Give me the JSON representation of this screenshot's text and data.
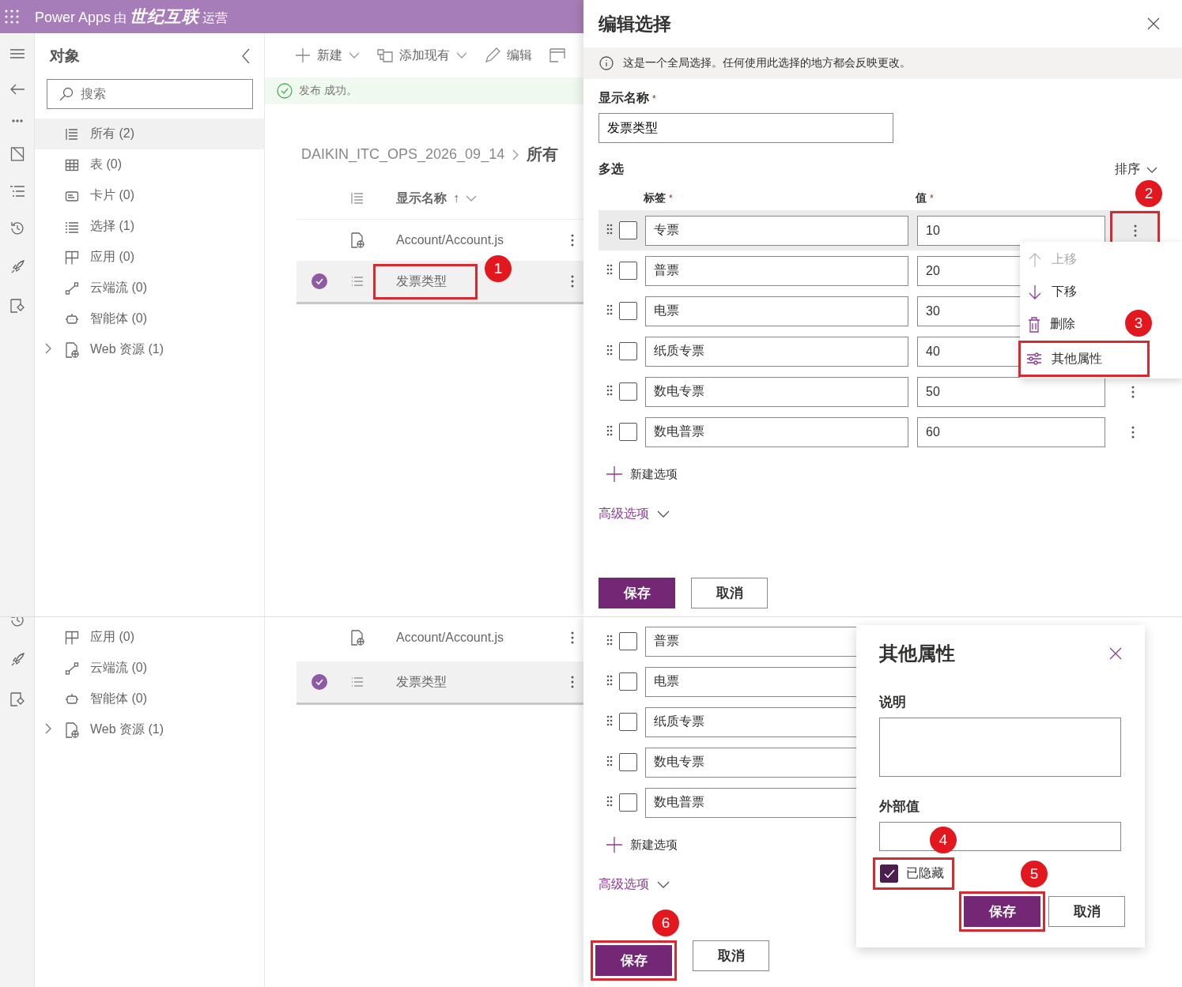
{
  "top": {
    "app_bar": {
      "product": "Power Apps",
      "by": "由",
      "operator": "世纪互联",
      "suffix": "运营"
    },
    "sidebar": {
      "title": "对象",
      "search": {
        "placeholder": "搜索"
      },
      "items": [
        {
          "label": "所有",
          "count": "(2)",
          "selected": true
        },
        {
          "label": "表",
          "count": "(0)",
          "selected": false
        },
        {
          "label": "卡片",
          "count": "(0)",
          "selected": false
        },
        {
          "label": "选择",
          "count": "(1)",
          "selected": false
        },
        {
          "label": "应用",
          "count": "(0)",
          "selected": false
        },
        {
          "label": "云端流",
          "count": "(0)",
          "selected": false
        },
        {
          "label": "智能体",
          "count": "(0)",
          "selected": false
        },
        {
          "label": "Web 资源",
          "count": "(1)",
          "selected": false,
          "expanded": false
        }
      ]
    },
    "toolbar": [
      {
        "label": "新建",
        "has_menu": true
      },
      {
        "label": "添加现有",
        "has_menu": true
      },
      {
        "label": "编辑",
        "has_menu": false
      }
    ],
    "notice": "发布 成功。",
    "breadcrumb": [
      "DAIKIN_ITC_OPS_2026_09_14",
      "所有"
    ],
    "table": {
      "column": "显示名称",
      "sort_mark": "↑",
      "rows": [
        {
          "name": "Account/Account.js",
          "selected": false
        },
        {
          "name": "发票类型",
          "selected": true,
          "badge": "1"
        }
      ]
    },
    "panel": {
      "title": "编辑选择",
      "info": "这是一个全局选择。任何使用此选择的地方都会反映更改。",
      "name_label": "显示名称",
      "name_required_mark": "*",
      "name_value": "发票类型",
      "section": "多选",
      "sort": "排序",
      "label_column": "标签",
      "label_required_mark": "*",
      "value_column": "值",
      "value_required_mark": "*",
      "options": [
        {
          "label": "专票",
          "value": "10",
          "checked": false,
          "selected": true
        },
        {
          "label": "普票",
          "value": "20",
          "checked": false,
          "selected": false
        },
        {
          "label": "电票",
          "value": "30",
          "checked": false,
          "selected": false
        },
        {
          "label": "纸质专票",
          "value": "40",
          "checked": false,
          "selected": false
        },
        {
          "label": "数电专票",
          "value": "50",
          "checked": false,
          "selected": false
        },
        {
          "label": "数电普票",
          "value": "60",
          "checked": false,
          "selected": false
        }
      ],
      "more_badge": "2",
      "menu": [
        {
          "label": "上移",
          "disabled": true
        },
        {
          "label": "下移",
          "disabled": false
        },
        {
          "label": "删除",
          "disabled": false
        },
        {
          "label": "其他属性",
          "disabled": false,
          "badge": "3"
        }
      ],
      "add": "新建选项",
      "advanced": "高级选项",
      "buttons": [
        {
          "label": "保存",
          "kind": "primary"
        },
        {
          "label": "取消",
          "kind": "secondary"
        }
      ]
    }
  },
  "bottom": {
    "sidebar_items": [
      {
        "label": "应用",
        "count": "(0)"
      },
      {
        "label": "云端流",
        "count": "(0)"
      },
      {
        "label": "智能体",
        "count": "(0)"
      },
      {
        "label": "Web 资源",
        "count": "(1)",
        "expanded": false
      }
    ],
    "table_rows": [
      {
        "name": "Account/Account.js",
        "selected": false
      },
      {
        "name": "发票类型",
        "selected": true
      }
    ],
    "options": [
      {
        "label": "普票",
        "checked": false
      },
      {
        "label": "电票",
        "checked": false
      },
      {
        "label": "纸质专票",
        "checked": false
      },
      {
        "label": "数电专票",
        "checked": false
      },
      {
        "label": "数电普票",
        "checked": false
      }
    ],
    "add": "新建选项",
    "advanced": "高级选项",
    "buttons": [
      {
        "label": "保存",
        "kind": "primary",
        "badge": "6"
      },
      {
        "label": "取消",
        "kind": "secondary"
      }
    ],
    "dialog": {
      "title": "其他属性",
      "fields": [
        {
          "label": "说明",
          "kind": "textarea"
        },
        {
          "label": "外部值",
          "kind": "input"
        }
      ],
      "hidden_option": {
        "label": "已隐藏",
        "checked": true,
        "badge": "4"
      },
      "buttons": [
        {
          "label": "保存",
          "kind": "primary",
          "badge": "5"
        },
        {
          "label": "取消",
          "kind": "secondary"
        }
      ]
    }
  }
}
